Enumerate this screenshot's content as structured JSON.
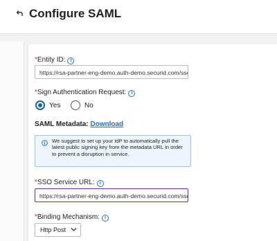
{
  "header": {
    "title": "Configure SAML"
  },
  "entity_id": {
    "label": "Entity ID:",
    "value": "https://rsa-partner-eng-demo.auth-demo.securid.com/sso/"
  },
  "sign_request": {
    "label": "Sign Authentication Request:",
    "options": [
      {
        "label": "Yes",
        "selected": true
      },
      {
        "label": "No",
        "selected": false
      }
    ]
  },
  "metadata": {
    "label": "SAML Metadata:",
    "link": "Download"
  },
  "notice": {
    "text": "We suggest to set up your IdP to automatically pull the latest public signing key from the metadata URL in order to prevent a disruption in service."
  },
  "sso_url": {
    "label": "SSO Service URL:",
    "value": "https://rsa-partner-eng-demo.auth-demo.securid.com/sso"
  },
  "binding": {
    "label": "Binding Mechanism:",
    "selected": "Http Post"
  },
  "colors": {
    "accent": "#1565a8",
    "link": "#1a73c8",
    "focus_border": "#6a2fa8",
    "required": "#c62828"
  }
}
